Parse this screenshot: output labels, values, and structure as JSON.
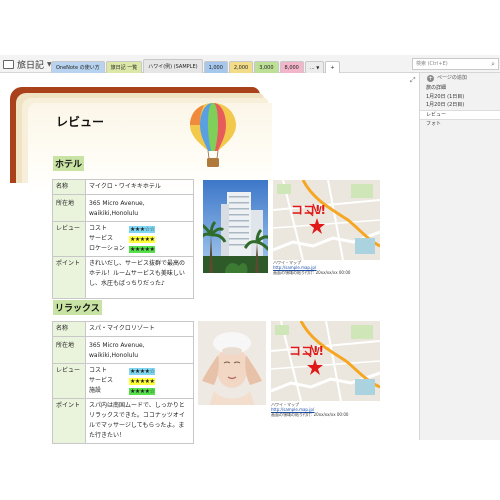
{
  "app": {
    "notebook_name": "旅日記",
    "tabs": [
      {
        "label": "OneNote の使い方",
        "color": "#b8d3ef"
      },
      {
        "label": "旅日記 一覧",
        "color": "#dbe8a8"
      },
      {
        "label": "ハワイ(例) (SAMPLE)",
        "color": "#e6e6e6",
        "active": true
      },
      {
        "label": "1,000",
        "color": "#a6c8ec"
      },
      {
        "label": "2,000",
        "color": "#f3dc88"
      },
      {
        "label": "3,000",
        "color": "#bddf96"
      },
      {
        "label": "8,000",
        "color": "#f2b5c9"
      },
      {
        "label": "...",
        "color": "#ececec"
      },
      {
        "label": "+",
        "color": "#ffffff"
      }
    ],
    "search_placeholder": "検索 (Ctrl+E)"
  },
  "pages_panel": {
    "add_page_label": "ページの追加",
    "items": [
      {
        "label": "旅の詳細",
        "selected": false
      },
      {
        "label": "1月20日 (1日目)",
        "selected": false
      },
      {
        "label": "1月20日 (2日目)",
        "selected": false
      },
      {
        "label": "レビュー",
        "selected": true
      },
      {
        "label": "フォト",
        "selected": false
      }
    ]
  },
  "page": {
    "title": "レビュー",
    "hotel": {
      "section_label": "ホテル",
      "rows": {
        "name_key": "名称",
        "name_value": "マイクロ・ワイキキホテル",
        "address_key": "所在地",
        "address_value": "365 Micro Avenue, waikiki,Honolulu",
        "review_key": "レビュー",
        "ratings": [
          {
            "label": "コスト",
            "stars": "★★★☆☆",
            "color": "#7fd6f2"
          },
          {
            "label": "サービス",
            "stars": "★★★★★",
            "color": "#ffff3a"
          },
          {
            "label": "ロケーション",
            "stars": "★★★★★",
            "color": "#57e04b"
          }
        ],
        "point_key": "ポイント",
        "point_value": "きれいだし、サービス抜群で最高のホテル！ルームサービスも美味しいし、水圧もばっちりだった♪"
      },
      "map_caption_place": "ハワイ・マップ",
      "map_caption_url": "http://sample.map.jp/",
      "map_caption_date": "画面の領域の貼り付け: 20xx/xx/xx 00:00"
    },
    "relax": {
      "section_label": "リラックス",
      "rows": {
        "name_key": "名称",
        "name_value": "スパ・マイクロリゾート",
        "address_key": "所在地",
        "address_value": "365 Micro Avenue, waikiki,Honolulu",
        "review_key": "レビュー",
        "ratings": [
          {
            "label": "コスト",
            "stars": "★★★★☆",
            "color": "#7fd6f2"
          },
          {
            "label": "サービス",
            "stars": "★★★★★",
            "color": "#ffff3a"
          },
          {
            "label": "施設",
            "stars": "★★★★☆",
            "color": "#57e04b"
          }
        ],
        "point_key": "ポイント",
        "point_value": "スパ内は南国ムードで、しっかりとリラックスできた。ココナッツオイルでマッサージしてもらったよ。また行きたい！"
      },
      "map_caption_place": "ハワイ・マップ",
      "map_caption_url": "http://sample.map.jp/",
      "map_caption_date": "画面の領域の貼り付け: 20xx/xx/xx 00:00"
    },
    "map_marker_text": "ココ!!"
  }
}
